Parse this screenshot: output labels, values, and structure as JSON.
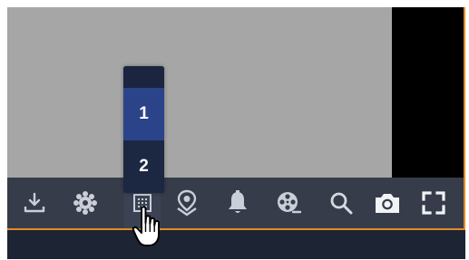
{
  "player": {
    "layout_menu": {
      "options": [
        "1",
        "2"
      ],
      "selected": "1"
    },
    "toolbar": {
      "buttons": [
        {
          "id": "download",
          "icon": "download-icon"
        },
        {
          "id": "settings",
          "icon": "gear-icon"
        },
        {
          "id": "layout",
          "icon": "grid-layout-icon",
          "active": true
        },
        {
          "id": "location",
          "icon": "location-pin-icon"
        },
        {
          "id": "alarm",
          "icon": "bell-icon"
        },
        {
          "id": "film",
          "icon": "film-reel-icon"
        },
        {
          "id": "search",
          "icon": "search-icon"
        },
        {
          "id": "snapshot",
          "icon": "camera-icon"
        },
        {
          "id": "fullscreen",
          "icon": "fullscreen-icon"
        }
      ]
    },
    "colors": {
      "accent_border": "#e58a24",
      "toolbar_bg": "#363c49",
      "menu_selected": "#2b4489",
      "menu_bg": "#1c2742"
    }
  }
}
